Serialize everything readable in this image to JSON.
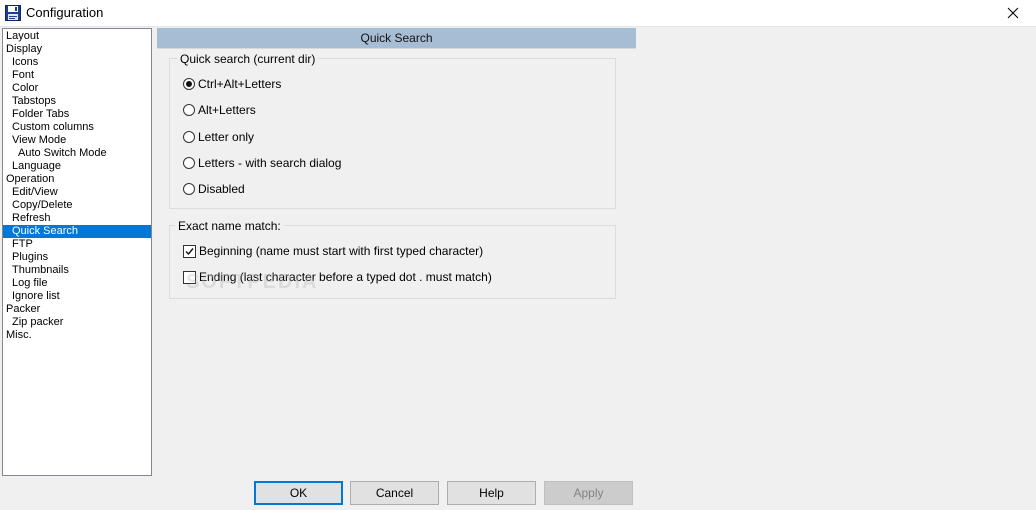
{
  "window": {
    "title": "Configuration",
    "close_glyph": "✕",
    "app_icon": "floppy-disk-icon"
  },
  "tree": {
    "items": [
      {
        "label": "Layout",
        "level": 0
      },
      {
        "label": "Display",
        "level": 0
      },
      {
        "label": "Icons",
        "level": 1
      },
      {
        "label": "Font",
        "level": 1
      },
      {
        "label": "Color",
        "level": 1
      },
      {
        "label": "Tabstops",
        "level": 1
      },
      {
        "label": "Folder Tabs",
        "level": 1
      },
      {
        "label": "Custom columns",
        "level": 1
      },
      {
        "label": "View Mode",
        "level": 1
      },
      {
        "label": "Auto Switch Mode",
        "level": 2
      },
      {
        "label": "Language",
        "level": 1
      },
      {
        "label": "Operation",
        "level": 0
      },
      {
        "label": "Edit/View",
        "level": 1
      },
      {
        "label": "Copy/Delete",
        "level": 1
      },
      {
        "label": "Refresh",
        "level": 1
      },
      {
        "label": "Quick Search",
        "level": 1,
        "selected": true
      },
      {
        "label": "FTP",
        "level": 1
      },
      {
        "label": "Plugins",
        "level": 1
      },
      {
        "label": "Thumbnails",
        "level": 1
      },
      {
        "label": "Log file",
        "level": 1
      },
      {
        "label": "Ignore list",
        "level": 1
      },
      {
        "label": "Packer",
        "level": 0
      },
      {
        "label": "Zip packer",
        "level": 1
      },
      {
        "label": "Misc.",
        "level": 0
      }
    ]
  },
  "panel": {
    "title": "Quick Search",
    "quick_search": {
      "label": "Quick search (current dir)",
      "options": [
        {
          "label": "Ctrl+Alt+Letters",
          "selected": true
        },
        {
          "label": "Alt+Letters",
          "selected": false
        },
        {
          "label": "Letter only",
          "selected": false
        },
        {
          "label": "Letters - with search dialog",
          "selected": false
        },
        {
          "label": "Disabled",
          "selected": false
        }
      ]
    },
    "exact_match": {
      "label": "Exact name match:",
      "options": [
        {
          "label": "Beginning (name must start with first typed character)",
          "checked": true
        },
        {
          "label": "Ending (last character before a typed dot . must match)",
          "checked": false
        }
      ]
    }
  },
  "buttons": {
    "ok": "OK",
    "cancel": "Cancel",
    "help": "Help",
    "apply": "Apply"
  },
  "watermark": "SOFTPEDIA",
  "colors": {
    "selection": "#0078d7",
    "header": "#a6bdd4"
  }
}
